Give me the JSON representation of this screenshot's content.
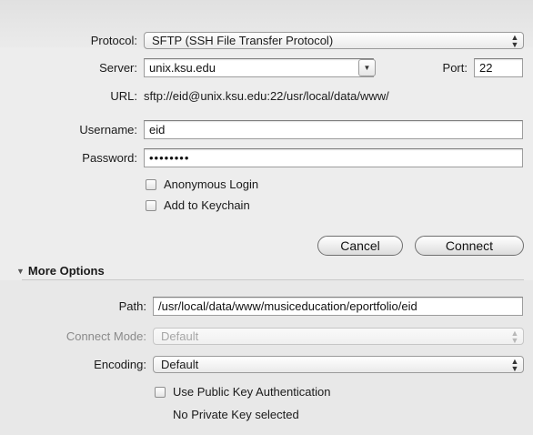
{
  "connection": {
    "protocol_label": "Protocol:",
    "protocol_value": "SFTP (SSH File Transfer Protocol)",
    "server_label": "Server:",
    "server_value": "unix.ksu.edu",
    "port_label": "Port:",
    "port_value": "22",
    "url_label": "URL:",
    "url_value": "sftp://eid@unix.ksu.edu:22/usr/local/data/www/",
    "username_label": "Username:",
    "username_value": "eid",
    "password_label": "Password:",
    "password_value": "••••••••",
    "anonymous_label": "Anonymous Login",
    "keychain_label": "Add to Keychain"
  },
  "buttons": {
    "cancel_label": "Cancel",
    "connect_label": "Connect"
  },
  "more_options": {
    "title": "More Options",
    "path_label": "Path:",
    "path_value": "/usr/local/data/www/musiceducation/eportfolio/eid",
    "connect_mode_label": "Connect Mode:",
    "connect_mode_value": "Default",
    "encoding_label": "Encoding:",
    "encoding_value": "Default",
    "public_key_label": "Use Public Key Authentication",
    "private_key_status": "No Private Key selected"
  },
  "icons": {
    "popup_arrows": "updown-arrows-icon",
    "combo_arrow": "down-arrow-icon",
    "disclosure": "disclosure-triangle-down-icon"
  },
  "colors": {
    "sheet_background": "#ededed",
    "disabled_text": "#a6a6a6"
  }
}
